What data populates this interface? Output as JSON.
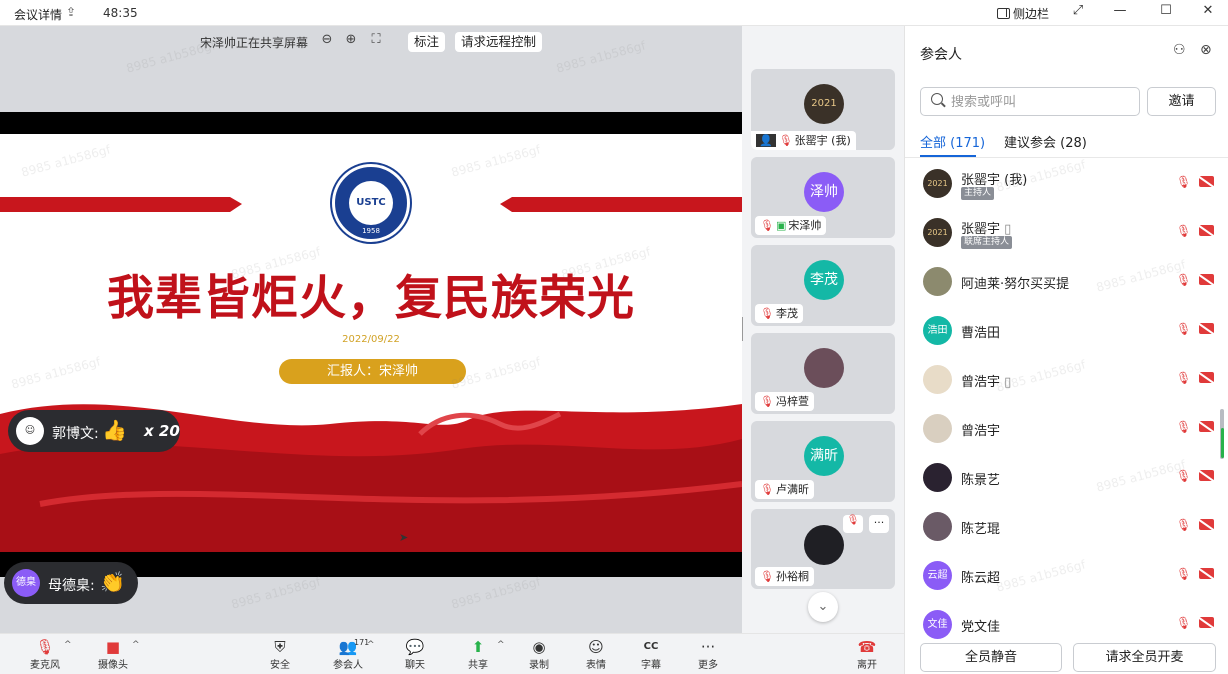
{
  "titlebar": {
    "meeting_info": "会议详情",
    "share_icon": "share-icon",
    "elapsed": "48:35",
    "sidebar_toggle": "侧边栏",
    "win_icons": [
      "fullscreen-icon",
      "minimize-icon",
      "maximize-icon",
      "close-icon"
    ]
  },
  "share": {
    "status": "宋泽帅正在共享屏幕",
    "zoom_out_icon": "zoom-out-icon",
    "zoom_in_icon": "zoom-in-icon",
    "fit_icon": "fit-screen-icon",
    "annotate": "标注",
    "remote_control": "请求远程控制"
  },
  "slide": {
    "logo_text": "USTC",
    "logo_year": "1958",
    "headline": "我辈皆炬火，复民族荣光",
    "date": "2022/09/22",
    "reporter": "汇报人：宋泽帅"
  },
  "reactions": [
    {
      "avatar": "",
      "name": "郭博文:",
      "emoji": "👍",
      "count": "x 20"
    },
    {
      "avatar": "德臬",
      "name": "母德臬:",
      "emoji": "👏",
      "count": ""
    }
  ],
  "watermark": "8985 a1b586gf",
  "gallery": [
    {
      "avatar": "2021",
      "label": "张罂宇 (我)",
      "color": "#3a3128",
      "self": true
    },
    {
      "avatar": "泽帅",
      "label": "宋泽帅",
      "color": "#8b5cf6",
      "sharing": true
    },
    {
      "avatar": "李茂",
      "label": "李茂",
      "color": "#14b8a6"
    },
    {
      "avatar": "",
      "label": "冯梓萱",
      "color": "#6b4e5a"
    },
    {
      "avatar": "满昕",
      "label": "卢满昕",
      "color": "#14b8a6"
    },
    {
      "avatar": "",
      "label": "孙裕桐",
      "color": "#1f1f24",
      "more": true
    }
  ],
  "toolbar": [
    {
      "icon": "mic-off-icon",
      "label": "麦克风",
      "caret": true
    },
    {
      "icon": "camera-off-icon",
      "label": "摄像头",
      "caret": true
    },
    {
      "icon": "shield-icon",
      "label": "安全"
    },
    {
      "icon": "participants-icon",
      "label": "参会人",
      "badge": "171",
      "caret": true
    },
    {
      "icon": "chat-icon",
      "label": "聊天"
    },
    {
      "icon": "share-screen-icon",
      "label": "共享",
      "caret": true
    },
    {
      "icon": "record-icon",
      "label": "录制"
    },
    {
      "icon": "emoji-icon",
      "label": "表情"
    },
    {
      "icon": "cc-icon",
      "label": "字幕"
    },
    {
      "icon": "more-icon",
      "label": "更多"
    },
    {
      "icon": "leave-icon",
      "label": "离开"
    }
  ],
  "sidebar": {
    "title": "参会人",
    "search_placeholder": "搜索或呼叫",
    "invite": "邀请",
    "tabs": [
      "全部 (171)",
      "建议参会 (28)"
    ],
    "participants": [
      {
        "name": "张罂宇 (我)",
        "tag": "主持人",
        "avatar": "2021",
        "color": "#3a3128"
      },
      {
        "name": "张罂宇",
        "tag": "联席主持人",
        "avatar": "2021",
        "color": "#3a3128",
        "device": true
      },
      {
        "name": "阿迪莱·努尔买买提",
        "avatar": "",
        "color": "#8c8a6e"
      },
      {
        "name": "曹浩田",
        "avatar": "浩田",
        "color": "#14b8a6"
      },
      {
        "name": "曾浩宇",
        "avatar": "",
        "color": "#e8dcc8",
        "device": true
      },
      {
        "name": "曾浩宇",
        "avatar": "",
        "color": "#d9cfc0"
      },
      {
        "name": "陈景艺",
        "avatar": "",
        "color": "#2a2230"
      },
      {
        "name": "陈艺琨",
        "avatar": "",
        "color": "#6a5a66"
      },
      {
        "name": "陈云超",
        "avatar": "云超",
        "color": "#8b5cf6"
      },
      {
        "name": "党文佳",
        "avatar": "文佳",
        "color": "#8b5cf6"
      }
    ],
    "mute_all": "全员静音",
    "unmute_all": "请求全员开麦"
  },
  "colors": {
    "accent": "#1565d8",
    "danger": "#e03a3a",
    "slide_red": "#c0111a",
    "gold": "#d9a11d"
  }
}
